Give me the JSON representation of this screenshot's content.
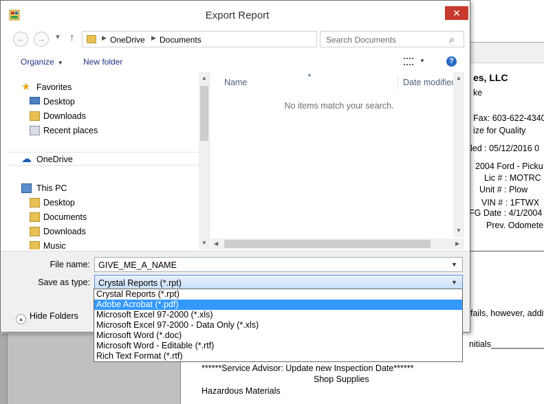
{
  "dialog": {
    "title": "Export Report",
    "close_glyph": "✕"
  },
  "address": {
    "crumbs": [
      "OneDrive",
      "Documents"
    ],
    "search_placeholder": "Search Documents"
  },
  "toolbar": {
    "organize": "Organize",
    "new_folder": "New folder"
  },
  "nav": {
    "favorites": "Favorites",
    "desktop": "Desktop",
    "downloads": "Downloads",
    "recent": "Recent places",
    "onedrive": "OneDrive",
    "this_pc": "This PC",
    "pc_desktop": "Desktop",
    "pc_documents": "Documents",
    "pc_downloads": "Downloads",
    "pc_music": "Music"
  },
  "files": {
    "col_name": "Name",
    "col_date": "Date modified",
    "empty": "No items match your search."
  },
  "save": {
    "file_name_label": "File name:",
    "file_name_value": "GIVE_ME_A_NAME",
    "type_label": "Save as type:",
    "type_value": "Crystal Reports (*.rpt)",
    "hide_folders": "Hide Folders",
    "type_options": [
      "Crystal Reports (*.rpt)",
      "Adobe Acrobat (*.pdf)",
      "Microsoft Excel 97-2000 (*.xls)",
      "Microsoft Excel 97-2000 - Data Only (*.xls)",
      "Microsoft Word (*.doc)",
      "Microsoft Word - Editable (*.rtf)",
      "Rich Text Format (*.rtf)"
    ],
    "highlighted_option_index": 1
  },
  "report": {
    "company": "es, LLC",
    "line2": "ke",
    "fax": "Fax: 603-622-4340",
    "quality": "ize for Quality",
    "date": "led : 05/12/2016 0",
    "vehicle": "2004 Ford - Picku",
    "lic": "Lic # :  MOTRC",
    "unit": "Unit # :  Plow",
    "vin": "VIN # :  1FTWX",
    "mfg": "FG Date :  4/1/2004",
    "odometer": "Prev. Odomete",
    "fails": "fails, however, addit",
    "initials": "nitials_______________",
    "advisor": "******Service Advisor: Update new Inspection Date******",
    "shop": "Shop Supplies",
    "hazardous": "Hazardous Materials"
  }
}
